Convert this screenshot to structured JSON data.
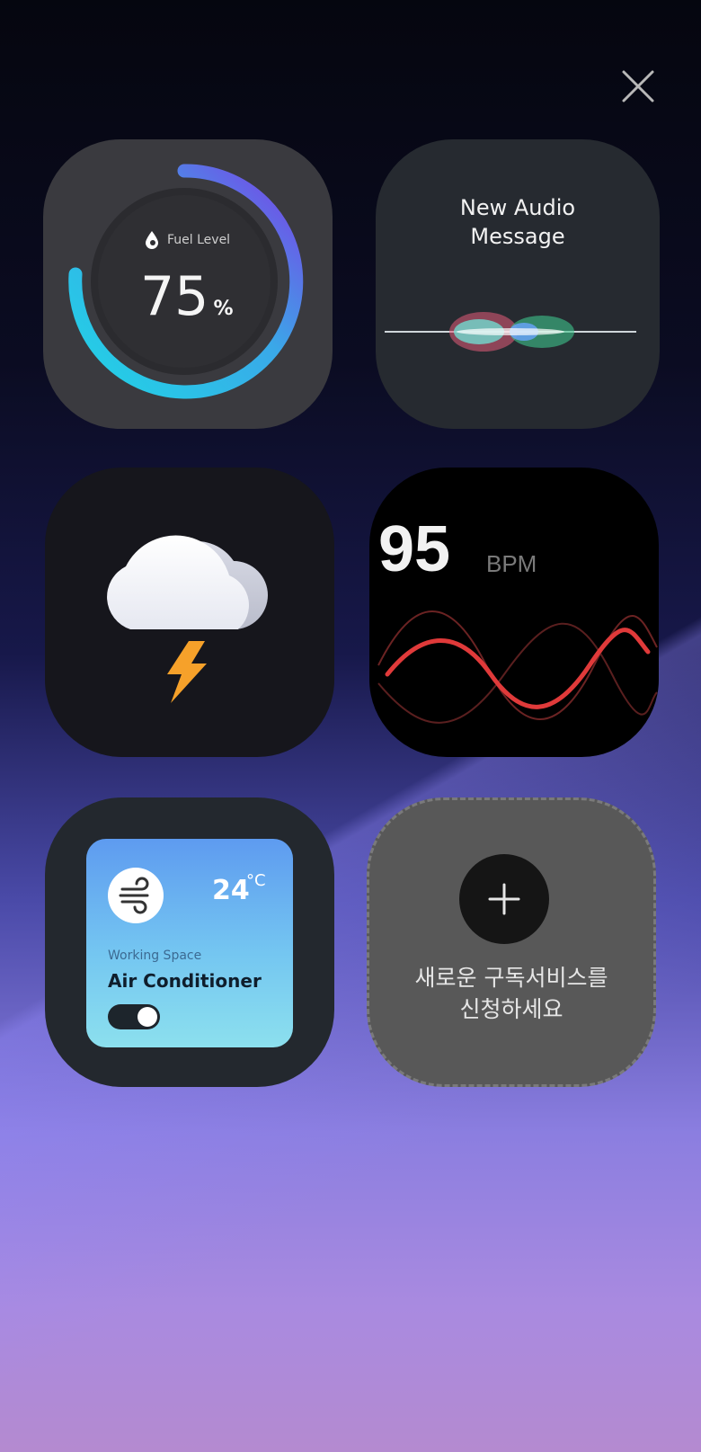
{
  "icons": {
    "close": "close-icon",
    "fuel": "drop-icon",
    "weather": "thunderstorm-icon",
    "ac": "wind-icon",
    "add": "plus-icon"
  },
  "fuel": {
    "label": "Fuel Level",
    "value": "75",
    "unit": "%",
    "level": 0.75
  },
  "audio": {
    "title": "New Audio\nMessage"
  },
  "bpm": {
    "value": "95",
    "unit": "BPM"
  },
  "ac": {
    "temperature": "24",
    "temperature_unit": "°C",
    "location": "Working Space",
    "name": "Air Conditioner",
    "on": true
  },
  "add": {
    "text": "새로운 구독서비스를\n신청하세요"
  },
  "colors": {
    "fuel_gauge_start": "#21d3e4",
    "fuel_gauge_end": "#7a3fe6",
    "bpm_wave": "#e03a3a"
  }
}
